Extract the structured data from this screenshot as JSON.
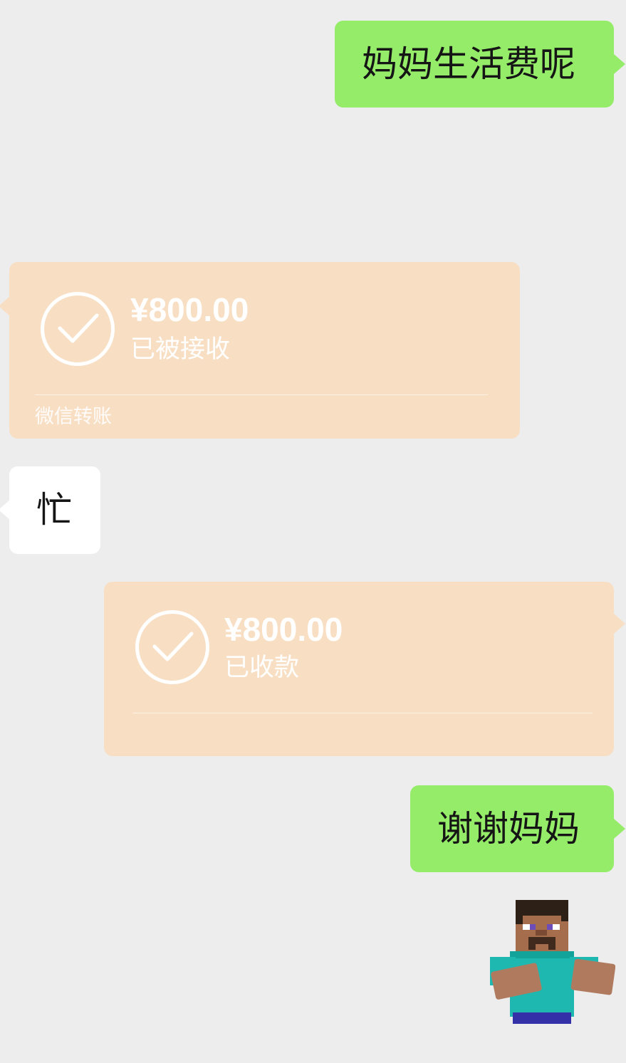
{
  "chat": {
    "messages": [
      {
        "side": "right",
        "type": "text",
        "text": "妈妈生活费呢"
      },
      {
        "type": "timestamp",
        "text": ""
      },
      {
        "side": "left",
        "type": "transfer",
        "amount": "¥800.00",
        "status": "已被接收",
        "footer": "微信转账"
      },
      {
        "side": "left",
        "type": "text",
        "text": "忙"
      },
      {
        "side": "right",
        "type": "transfer",
        "amount": "¥800.00",
        "status": "已收款",
        "footer": ""
      },
      {
        "side": "right",
        "type": "text",
        "text": "谢谢妈妈"
      },
      {
        "side": "right",
        "type": "sticker",
        "icon": "minecraft-steve-sticker"
      }
    ]
  },
  "colors": {
    "background": "#ededed",
    "sent_bubble": "#95ec69",
    "received_bubble": "#ffffff",
    "transfer_bubble": "#f8dfc4"
  }
}
